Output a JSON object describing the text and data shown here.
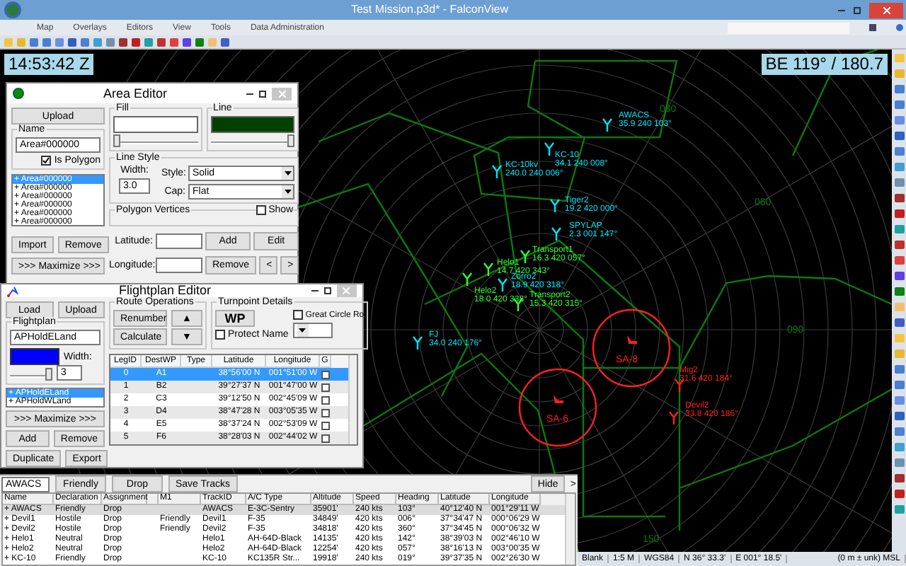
{
  "window": {
    "title": "Test Mission.p3d* - FalconView"
  },
  "menu": [
    "Map",
    "Overlays",
    "Editors",
    "View",
    "Tools",
    "Data Administration"
  ],
  "clock": "14:53:42 Z",
  "bullseye": "BE 119° / 180.7",
  "map": {
    "ring_labels": [
      "030",
      "060",
      "090",
      "150"
    ],
    "tracks": [
      {
        "kind": "aircraft",
        "name": "AWACS",
        "info": "35.9 240 103°",
        "color": "#00e5ff"
      },
      {
        "kind": "aircraft",
        "name": "KC-10",
        "info": "34.1 240 008°",
        "color": "#00e5ff"
      },
      {
        "kind": "aircraft",
        "name": "KC-10kv",
        "info": "240.0 240 006°",
        "color": "#00e5ff"
      },
      {
        "kind": "aircraft",
        "name": "Tiger2",
        "info": "19.2 420 000°",
        "color": "#00e5ff"
      },
      {
        "kind": "aircraft",
        "name": "SPYLAP",
        "info": "2.3 001 147°",
        "color": "#00e5ff"
      },
      {
        "kind": "aircraft",
        "name": "Transport1",
        "info": "16.3 420 057°",
        "color": "#33ff33"
      },
      {
        "kind": "aircraft",
        "name": "Helo1",
        "info": "14.7 420 343°",
        "color": "#33ff33"
      },
      {
        "kind": "aircraft",
        "name": "Zorro2",
        "info": "18.9 420 318°",
        "color": "#00e5ff"
      },
      {
        "kind": "aircraft",
        "name": "Helo2",
        "info": "18.0 420 338°",
        "color": "#33ff33"
      },
      {
        "kind": "aircraft",
        "name": "Transport2",
        "info": "15.3 420 315°",
        "color": "#33ff33"
      },
      {
        "kind": "aircraft",
        "name": "FJ",
        "info": "34.0 240 176°",
        "color": "#00e5ff"
      },
      {
        "kind": "sam",
        "name": "SA-8",
        "color": "#ff2020"
      },
      {
        "kind": "sam",
        "name": "SA-6",
        "color": "#ff2020"
      },
      {
        "kind": "aircraft",
        "name": "Mig2",
        "info": "31.6 420 184°",
        "color": "#ff2020"
      },
      {
        "kind": "aircraft",
        "name": "Devil2",
        "info": "33.8 420 186°",
        "color": "#ff2020"
      }
    ]
  },
  "area_editor": {
    "title": "Area Editor",
    "upload": "Upload",
    "fill_label": "Fill",
    "line_label": "Line",
    "fill_slider": {
      "level": 0
    },
    "line_slider": {
      "level": 1
    },
    "name_label": "Name",
    "name_value": "Area#000000",
    "is_polygon": {
      "label": "Is Polygon",
      "checked": true
    },
    "areas": [
      {
        "label": "+ Area#000000",
        "selected": true
      },
      {
        "label": "+ Area#000000",
        "selected": false
      },
      {
        "label": "+ Area#000000",
        "selected": false
      },
      {
        "label": "+ Area#000000",
        "selected": false
      },
      {
        "label": "+ Area#000000",
        "selected": false
      },
      {
        "label": "+ Area#000000",
        "selected": false
      }
    ],
    "line_style_label": "Line Style",
    "width_label": "Width:",
    "width_value": "3.0",
    "style_label": "Style:",
    "style_value": "Solid",
    "cap_label": "Cap:",
    "cap_value": "Flat",
    "vertices_label": "Polygon Vertices",
    "show": {
      "label": "Show",
      "checked": false
    },
    "latitude_label": "Latitude:",
    "longitude_label": "Longitude:",
    "buttons": {
      "add": "Add",
      "edit": "Edit",
      "remove_vertex": "Remove",
      "prev": "<",
      "next": ">",
      "import": "Import",
      "remove": "Remove",
      "maximize": ">>> Maximize >>>"
    }
  },
  "flightplan_editor": {
    "title": "Flightplan Editor",
    "load": "Load",
    "upload": "Upload",
    "flightplan_label": "Flightplan",
    "name_value": "APHoldELand",
    "width_label": "Width:",
    "width_value": "3",
    "width_slider": {
      "level": 1
    },
    "plans": [
      {
        "label": "+ APHoldELand",
        "selected": true
      },
      {
        "label": "+ APHoldWLand",
        "selected": false
      }
    ],
    "maximize": ">>> Maximize >>>",
    "add": "Add",
    "remove": "Remove",
    "duplicate": "Duplicate",
    "export": "Export",
    "route_label": "Route Operations",
    "renumber": "Renumber",
    "calculate": "Calculate",
    "up": "▲",
    "down": "▼",
    "turnpoint_label": "Turnpoint Details",
    "wp": "WP",
    "great_circle": {
      "label": "Great Circle Ro",
      "checked": false
    },
    "protect_name": {
      "label": "Protect Name",
      "checked": false
    },
    "columns": [
      "LegID",
      "DestWP",
      "Type",
      "Latitude",
      "Longitude",
      "G"
    ],
    "rows": [
      {
        "leg": "0",
        "dest": "A1",
        "lat": "38°56'00 N",
        "lon": "001°51'00 W",
        "g": false,
        "selected": true
      },
      {
        "leg": "1",
        "dest": "B2",
        "lat": "39°27'37 N",
        "lon": "001°47'00 W",
        "g": false,
        "selected": false
      },
      {
        "leg": "2",
        "dest": "C3",
        "lat": "39°12'50 N",
        "lon": "002°45'09 W",
        "g": false,
        "selected": false
      },
      {
        "leg": "3",
        "dest": "D4",
        "lat": "38°47'28 N",
        "lon": "003°05'35 W",
        "g": false,
        "selected": false
      },
      {
        "leg": "4",
        "dest": "E5",
        "lat": "38°37'24 N",
        "lon": "002°53'09 W",
        "g": false,
        "selected": false
      },
      {
        "leg": "5",
        "dest": "F6",
        "lat": "38°28'03 N",
        "lon": "002°44'02 W",
        "g": false,
        "selected": false
      }
    ]
  },
  "tracks_panel": {
    "search_value": "AWACS",
    "friendly": "Friendly",
    "drop": "Drop",
    "save_tracks": "Save Tracks",
    "hide": "Hide",
    "more": ">",
    "columns": [
      "Name",
      "Declaration",
      "Assignment",
      "",
      "M1",
      "TrackID",
      "A/C Type",
      "Altitude",
      "Speed",
      "Heading",
      "Latitude",
      "Longitude"
    ],
    "rows": [
      {
        "selected": true,
        "cells": [
          "+ AWACS",
          "Friendly",
          "Drop",
          "",
          "",
          "AWACS",
          "E-3C-Sentry",
          "35901'",
          "240 kts",
          "103°",
          "40°12'40 N",
          "001°29'11 W"
        ]
      },
      {
        "selected": false,
        "cells": [
          "+ Devil1",
          "Hostile",
          "Drop",
          "",
          "Friendly",
          "Devil1",
          "F-35",
          "34849'",
          "420 kts",
          "006°",
          "37°34'47 N",
          "000°06'29 W"
        ]
      },
      {
        "selected": false,
        "cells": [
          "+ Devil2",
          "Hostile",
          "Drop",
          "",
          "Friendly",
          "Devil2",
          "F-35",
          "34818'",
          "420 kts",
          "360°",
          "37°34'45 N",
          "000°06'32 W"
        ]
      },
      {
        "selected": false,
        "cells": [
          "+ Helo1",
          "Neutral",
          "Drop",
          "",
          "",
          "Helo1",
          "AH-64D-Black",
          "14135'",
          "420 kts",
          "142°",
          "38°39'03 N",
          "002°46'10 W"
        ]
      },
      {
        "selected": false,
        "cells": [
          "+ Helo2",
          "Neutral",
          "Drop",
          "",
          "",
          "Helo2",
          "AH-64D-Black",
          "12254'",
          "420 kts",
          "057°",
          "38°16'13 N",
          "003°00'35 W"
        ]
      },
      {
        "selected": false,
        "cells": [
          "+ KC-10",
          "Friendly",
          "Drop",
          "",
          "",
          "KC-10",
          "KC135R Str...",
          "19918'",
          "240 kts",
          "019°",
          "39°37'35 N",
          "002°26'30 W"
        ]
      }
    ]
  },
  "status_bar": [
    "Blank",
    "1:5 M",
    "WGS84",
    "N 36° 33.3'",
    "E 001° 18.5'",
    "(0 m ± unk) MSL"
  ]
}
